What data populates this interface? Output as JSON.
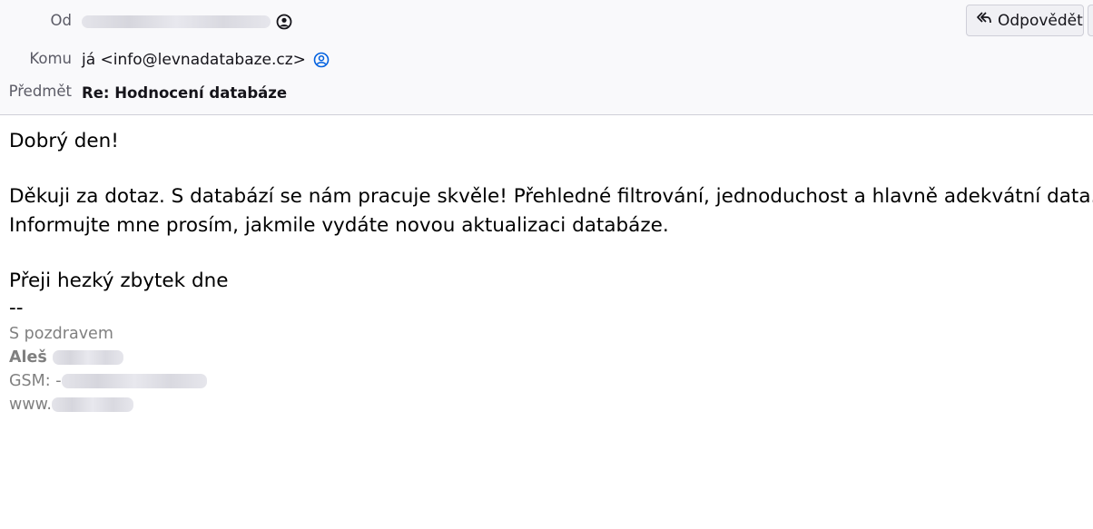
{
  "header": {
    "from_label": "Od",
    "to_label": "Komu",
    "to_value": "já <info@levnadatabaze.cz>",
    "subject_label": "Předmět",
    "subject_value": "Re: Hodnocení databáze",
    "reply_label": "Odpovědět"
  },
  "message": {
    "greeting": "Dobrý den!",
    "line1": "Děkuji za dotaz. S databází se nám pracuje skvěle! Přehledné filtrování, jednoduchost a hlavně adekvátní data.",
    "line2": "Informujte mne prosím, jakmile vydáte novou aktualizaci databáze.",
    "closing": "Přeji hezký zbytek dne",
    "separator": "--"
  },
  "signature": {
    "regards": "S pozdravem",
    "name": "Aleš",
    "phone_prefix": "GSM: -",
    "web_prefix": "www."
  },
  "colors": {
    "header_bg": "#f9f9fb",
    "accent_blue": "#0060df",
    "signature_gray": "#808080"
  }
}
